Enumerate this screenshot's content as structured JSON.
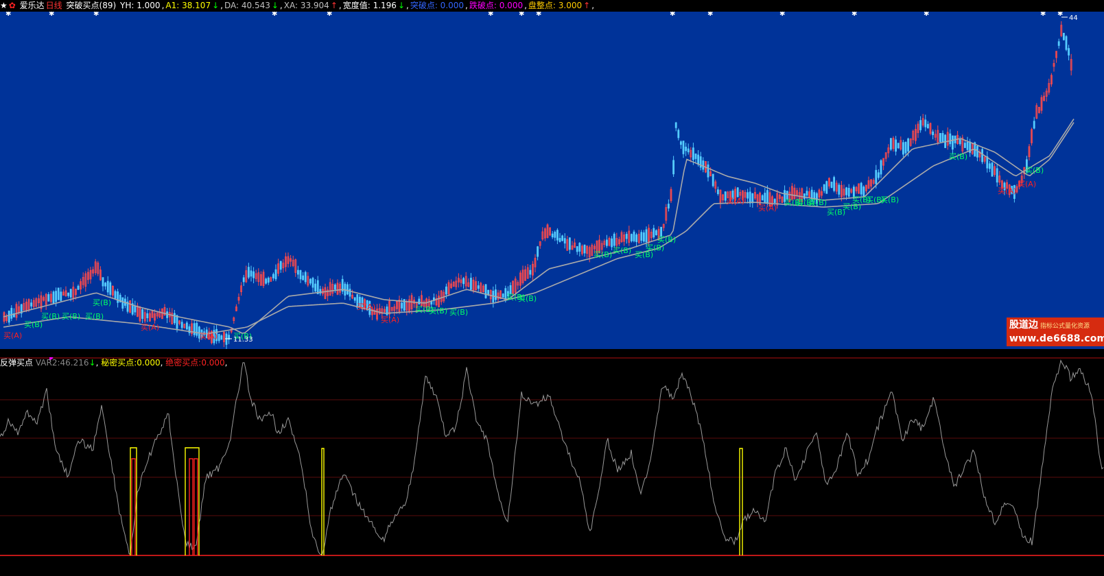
{
  "header": {
    "icons": [
      "star-icon",
      "red-flower-icon"
    ],
    "stock_name": "爱乐达",
    "period": "日线",
    "indicator": "突破买点(89)",
    "fields": [
      {
        "label": "YH:",
        "value": "1.000",
        "arrow": "",
        "color": "#ffffff"
      },
      {
        "label": "A1:",
        "value": "38.107",
        "arrow": "↓",
        "color": "#ffff00"
      },
      {
        "label": "DA:",
        "value": "40.543",
        "arrow": "↓",
        "color": "#c0c0c0"
      },
      {
        "label": "XA:",
        "value": "33.904",
        "arrow": "↑",
        "color": "#c0c0c0"
      },
      {
        "label": "宽度值:",
        "value": "1.196",
        "arrow": "↓",
        "color": "#ffffff"
      },
      {
        "label": "突破点:",
        "value": "0.000",
        "arrow": "",
        "color": "#3366ff"
      },
      {
        "label": "跌破点:",
        "value": "0.000",
        "arrow": "",
        "color": "#ff00ff"
      },
      {
        "label": "盘整点:",
        "value": "3.000",
        "arrow": "↑",
        "color": "#ffcc00"
      }
    ]
  },
  "price_chart": {
    "high_label": "44",
    "low_label": "11.33",
    "buy_a": "买(A)",
    "buy_b": "买(B)",
    "colors": {
      "background": "#003399",
      "up": "#ff4a4a",
      "down": "#55ccff",
      "ma": "#a9a9a9",
      "buy_a": "#ff2020",
      "buy_b": "#00ff66"
    }
  },
  "sub_header": {
    "title": "反弹买点",
    "var2_label": "VAR2:",
    "var2_value": "46.216",
    "var2_arrow": "↓",
    "secret_label": "秘密买点:",
    "secret_value": "0.000",
    "precise_label": "绝密买点:",
    "precise_value": "0.000"
  },
  "watermark": {
    "brand": "股道边",
    "tagline": "指标公式量化资源",
    "url": "www.de6688.com"
  }
}
